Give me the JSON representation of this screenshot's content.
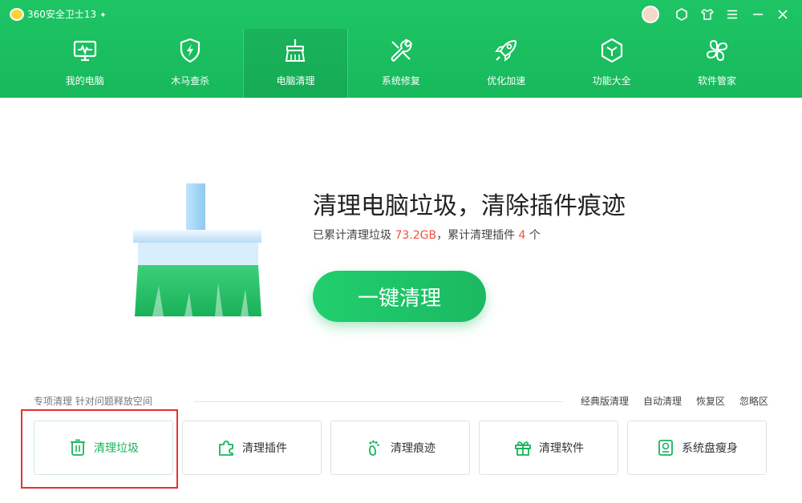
{
  "app": {
    "title": "360安全卫士13",
    "star": "✦"
  },
  "colors": {
    "brand_green": "#1ec565",
    "accent_red": "#f3503f",
    "highlight_red": "#e33333"
  },
  "nav": {
    "items": [
      {
        "label": "我的电脑",
        "icon": "monitor-icon"
      },
      {
        "label": "木马查杀",
        "icon": "shield-bolt-icon"
      },
      {
        "label": "电脑清理",
        "icon": "broom-icon",
        "active": true
      },
      {
        "label": "系统修复",
        "icon": "wrench-icon"
      },
      {
        "label": "优化加速",
        "icon": "rocket-icon"
      },
      {
        "label": "功能大全",
        "icon": "cube-icon"
      },
      {
        "label": "软件管家",
        "icon": "apps-icon"
      }
    ]
  },
  "hero": {
    "title": "清理电脑垃圾，清除插件痕迹",
    "sub_prefix": "已累计清理垃圾 ",
    "sub_size": "73.2GB",
    "sub_middle": "，累计清理插件 ",
    "sub_count": "4",
    "sub_suffix": " 个",
    "button_label": "一键清理"
  },
  "section": {
    "title": "专项清理  针对问题释放空间",
    "links": [
      "经典版清理",
      "自动清理",
      "恢复区",
      "忽略区"
    ]
  },
  "cards": [
    {
      "label": "清理垃圾",
      "icon": "trash-icon",
      "active": true
    },
    {
      "label": "清理插件",
      "icon": "puzzle-icon"
    },
    {
      "label": "清理痕迹",
      "icon": "footprint-icon"
    },
    {
      "label": "清理软件",
      "icon": "gift-box-icon"
    },
    {
      "label": "系统盘瘦身",
      "icon": "disk-icon"
    }
  ]
}
